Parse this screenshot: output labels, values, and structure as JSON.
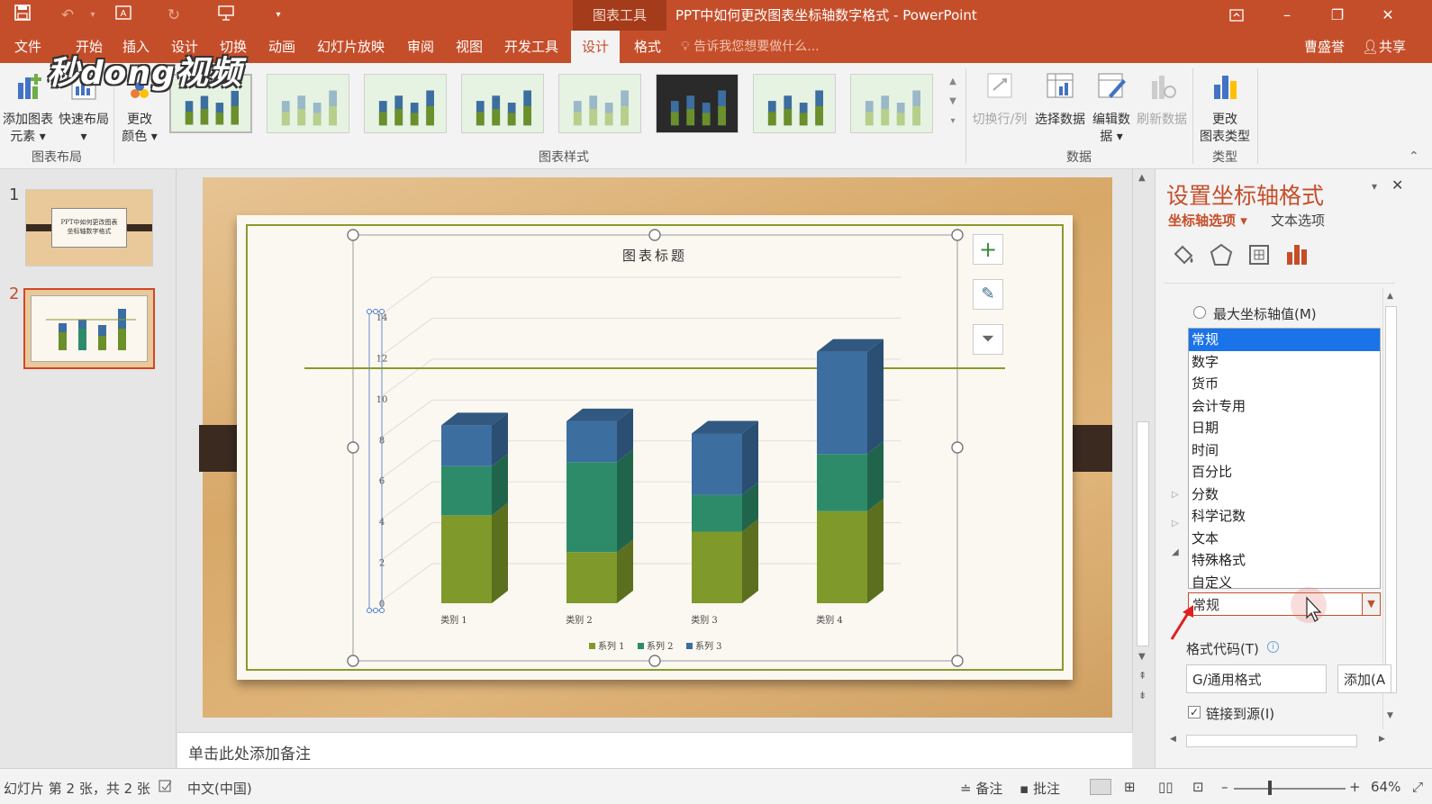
{
  "titlebar": {
    "context_tab": "图表工具",
    "title": "PPT中如何更改图表坐标轴数字格式 - PowerPoint",
    "minimize": "–",
    "restore": "❐",
    "close": "✕"
  },
  "tabs": [
    "文件",
    "开始",
    "插入",
    "设计",
    "切换",
    "动画",
    "幻灯片放映",
    "审阅",
    "视图",
    "开发工具",
    "设计",
    "格式"
  ],
  "active_tab_index": 10,
  "tell_me": "告诉我您想要做什么...",
  "user": {
    "name": "曹盛誉",
    "share": "共享"
  },
  "watermark": "秒dong视频",
  "ribbon": {
    "add_element": {
      "line1": "添加图表",
      "line2": "元素 ▾"
    },
    "quick_layout": {
      "line1": "快速布局",
      "line2": "▾"
    },
    "change_color": {
      "line1": "更改",
      "line2": "颜色 ▾"
    },
    "switch_rowcol": "切换行/列",
    "select_data": "选择数据",
    "edit_data": {
      "line1": "编辑数",
      "line2": "据 ▾"
    },
    "refresh_data": "刷新数据",
    "change_type": {
      "line1": "更改",
      "line2": "图表类型"
    },
    "groups": {
      "layout": "图表布局",
      "styles": "图表样式",
      "data": "数据",
      "type": "类型"
    },
    "style_thumbs": 8
  },
  "slides": [
    {
      "number": "1",
      "line1": "PPT中如何更改图表",
      "line2": "坐标轴数字格式"
    },
    {
      "number": "2"
    }
  ],
  "active_slide": 2,
  "notes_placeholder": "单击此处添加备注",
  "chart_data": {
    "type": "bar",
    "title": "图表标题",
    "categories": [
      "类别 1",
      "类别 2",
      "类别 3",
      "类别 4"
    ],
    "series": [
      {
        "name": "系列 1",
        "values": [
          4.3,
          2.5,
          3.5,
          4.5
        ],
        "color": "#7f9a2a"
      },
      {
        "name": "系列 2",
        "values": [
          2.4,
          4.4,
          1.8,
          2.8
        ],
        "color": "#2e8b6a"
      },
      {
        "name": "系列 3",
        "values": [
          2.0,
          2.0,
          3.0,
          5.0
        ],
        "color": "#3c6ea0"
      }
    ],
    "yticks": [
      "0",
      "2",
      "4",
      "6",
      "8",
      "10",
      "12",
      "14"
    ],
    "ylim": [
      0,
      14
    ],
    "stacked": true,
    "three_d": true,
    "legend_position": "bottom"
  },
  "chart_tools": {
    "add": "+",
    "brush": "✎",
    "filter": "⏷"
  },
  "pane": {
    "title": "设置坐标轴格式",
    "axis_options": "坐标轴选项 ▾",
    "text_options": "文本选项",
    "max_axis_label": "最大坐标轴值(M)",
    "category_list": [
      "常规",
      "数字",
      "货币",
      "会计专用",
      "日期",
      "时间",
      "百分比",
      "分数",
      "科学记数",
      "文本",
      "特殊格式",
      "自定义"
    ],
    "selected_category": "常规",
    "format_code_label": "格式代码(T)",
    "format_code_value": "G/通用格式",
    "add_button": "添加(A",
    "link_source": "链接到源(I)"
  },
  "status": {
    "slide_info": "幻灯片 第 2 张，共 2 张",
    "language": "中文(中国)",
    "notes": "备注",
    "comments": "批注",
    "zoom": "64%"
  },
  "colors": {
    "accent": "#c54e2a",
    "selection": "#1a73e8"
  }
}
